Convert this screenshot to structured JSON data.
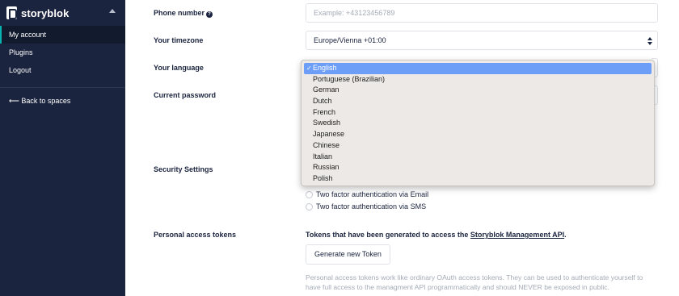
{
  "sidebar": {
    "brand": "storyblok",
    "items": [
      {
        "label": "My account"
      },
      {
        "label": "Plugins"
      },
      {
        "label": "Logout"
      }
    ],
    "back_label": "⟵ Back to spaces"
  },
  "form": {
    "phone": {
      "label": "Phone number",
      "placeholder": "Example: +43123456789"
    },
    "timezone": {
      "label": "Your timezone",
      "value": "Europe/Vienna +01:00"
    },
    "language": {
      "label": "Your language",
      "selected": "English",
      "options": [
        "English",
        "Portuguese (Brazilian)",
        "German",
        "Dutch",
        "French",
        "Swedish",
        "Japanese",
        "Chinese",
        "Italian",
        "Russian",
        "Polish"
      ]
    },
    "password": {
      "label": "Current password"
    },
    "security": {
      "label": "Security Settings",
      "options": [
        "Two factor authentication via Email",
        "Two factor authentication via SMS"
      ]
    },
    "tokens": {
      "label": "Personal access tokens",
      "description": "Tokens that have been generated to access the",
      "link": "Storyblok Management API",
      "description_end": ".",
      "button": "Generate new Token",
      "help": "Personal access tokens work like ordinary OAuth access tokens. They can be used to authenticate yourself to have full access to the managment API programmatically and should NEVER be exposed in public."
    }
  },
  "colors": {
    "sidebar_bg": "#1b243f",
    "accent": "#09b3af",
    "dropdown_highlight": "#6d9ef7"
  }
}
